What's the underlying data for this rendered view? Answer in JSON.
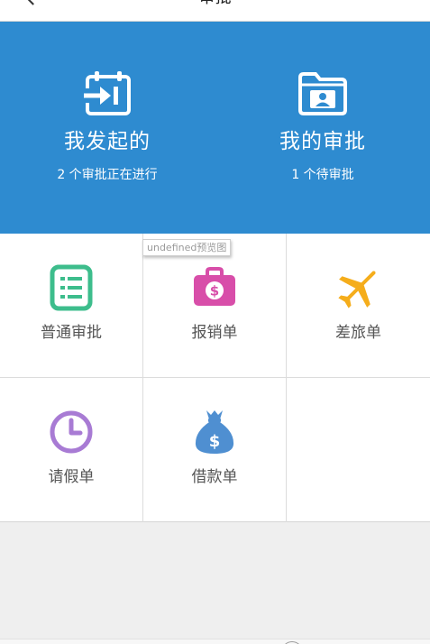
{
  "navbar": {
    "title": "审批"
  },
  "hero": {
    "left": {
      "title": "我发起的",
      "subtitle": "2 个审批正在进行",
      "icon": "calendar-import-icon"
    },
    "right": {
      "title": "我的审批",
      "subtitle": "1 个待审批",
      "icon": "contact-folder-icon"
    }
  },
  "tooltip": {
    "text": "undefined预览图"
  },
  "grid": {
    "items": [
      {
        "label": "普通审批",
        "icon": "list-document-icon",
        "color": "#3dbd8c"
      },
      {
        "label": "报销单",
        "icon": "dollar-briefcase-icon",
        "color": "#d84ea9"
      },
      {
        "label": "差旅单",
        "icon": "airplane-icon",
        "color": "#f5ad1b"
      },
      {
        "label": "请假单",
        "icon": "clock-icon",
        "color": "#a87bd4"
      },
      {
        "label": "借款单",
        "icon": "money-bag-icon",
        "color": "#4f8fd1"
      }
    ]
  },
  "colors": {
    "hero_bg": "#2e8bd0",
    "page_bg": "#efefef"
  }
}
